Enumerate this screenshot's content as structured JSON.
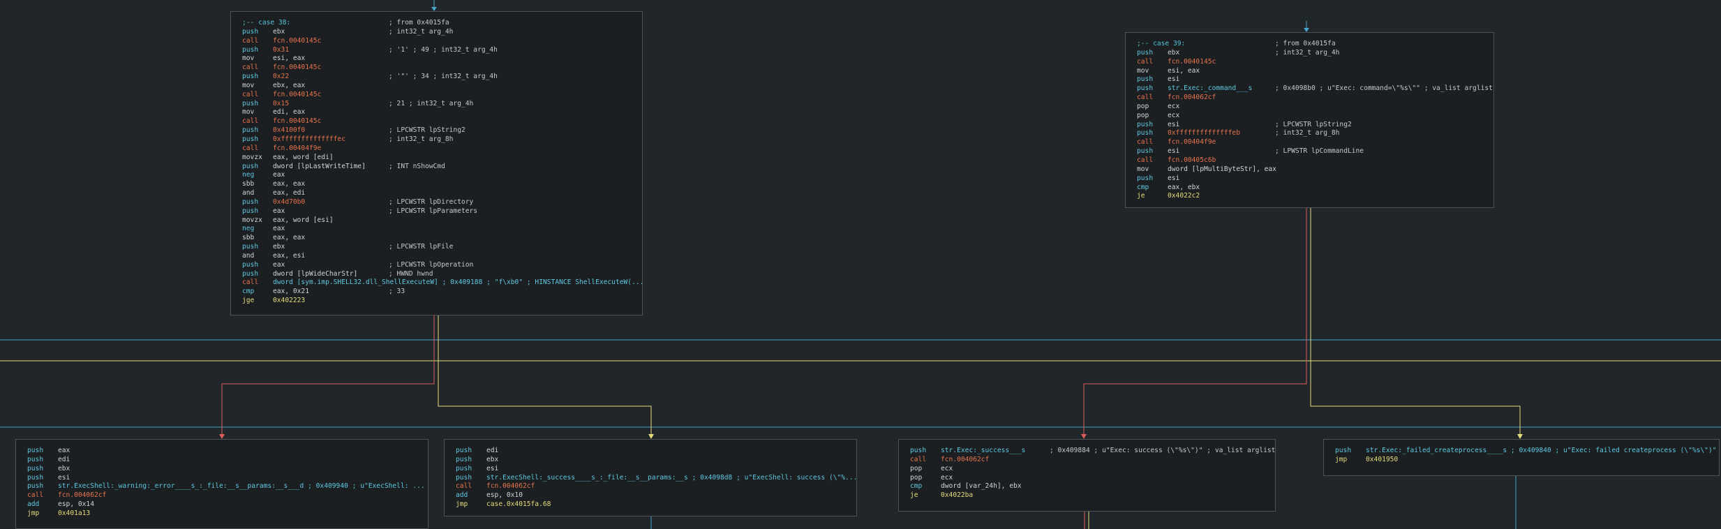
{
  "colors": {
    "background": "#21262a",
    "node_background": "#1b1f22",
    "node_border": "#4d5257",
    "edge_true": "#e6dc7a",
    "edge_false": "#e05c5c",
    "edge_unconditional": "#4aa3c8"
  },
  "nodes": {
    "case38": {
      "lines": [
        {
          "label": ";-- case 38:",
          "comment": "; from 0x4015fa"
        },
        {
          "m": "push",
          "o": "ebx",
          "ot": "reg",
          "c": "; int32_t arg_4h"
        },
        {
          "m": "call",
          "o": "fcn.0040145c",
          "ot": "fcn"
        },
        {
          "m": "push",
          "o": "0x31",
          "ot": "num-red",
          "c": "; '1' ; 49 ; int32_t arg_4h"
        },
        {
          "m": "mov",
          "o": "esi, eax",
          "ot": "reg"
        },
        {
          "m": "call",
          "o": "fcn.0040145c",
          "ot": "fcn"
        },
        {
          "m": "push",
          "o": "0x22",
          "ot": "num-red",
          "c": "; '\"' ; 34 ; int32_t arg_4h"
        },
        {
          "m": "mov",
          "o": "ebx, eax",
          "ot": "reg"
        },
        {
          "m": "call",
          "o": "fcn.0040145c",
          "ot": "fcn"
        },
        {
          "m": "push",
          "o": "0x15",
          "ot": "num-red",
          "c": "; 21 ; int32_t arg_4h"
        },
        {
          "m": "mov",
          "o": "edi, eax",
          "ot": "reg"
        },
        {
          "m": "call",
          "o": "fcn.0040145c",
          "ot": "fcn"
        },
        {
          "m": "push",
          "o": "0x4100f0",
          "ot": "num-red",
          "c": "; LPCWSTR lpString2"
        },
        {
          "m": "push",
          "o": "0xffffffffffffffec",
          "ot": "num-red",
          "c": "; int32_t arg_8h"
        },
        {
          "m": "call",
          "o": "fcn.00404f9e",
          "ot": "fcn"
        },
        {
          "m": "movzx",
          "o": "eax, word [edi]",
          "ot": "reg"
        },
        {
          "m": "push",
          "o": "dword [lpLastWriteTime]",
          "ot": "reg",
          "c": "; INT nShowCmd"
        },
        {
          "m": "neg",
          "o": "eax",
          "ot": "reg"
        },
        {
          "m": "sbb",
          "o": "eax, eax",
          "ot": "reg"
        },
        {
          "m": "and",
          "o": "eax, edi",
          "ot": "reg"
        },
        {
          "m": "push",
          "o": "0x4d70b0",
          "ot": "num-red",
          "c": "; LPCWSTR lpDirectory"
        },
        {
          "m": "push",
          "o": "eax",
          "ot": "reg",
          "c": "; LPCWSTR lpParameters"
        },
        {
          "m": "movzx",
          "o": "eax, word [esi]",
          "ot": "reg"
        },
        {
          "m": "neg",
          "o": "eax",
          "ot": "reg"
        },
        {
          "m": "sbb",
          "o": "eax, eax",
          "ot": "reg"
        },
        {
          "m": "push",
          "o": "ebx",
          "ot": "reg",
          "c": "; LPCWSTR lpFile"
        },
        {
          "m": "and",
          "o": "eax, esi",
          "ot": "reg"
        },
        {
          "m": "push",
          "o": "eax",
          "ot": "reg",
          "c": "; LPCWSTR lpOperation"
        },
        {
          "m": "push",
          "o": "dword [lpWideCharStr]",
          "ot": "reg",
          "c": "; HWND hwnd"
        },
        {
          "m": "call",
          "o": "dword [sym.imp.SHELL32.dll_ShellExecuteW] ; 0x409188 ; \"f\\xb0\" ; HINSTANCE ShellExecuteW(...",
          "ot": "str"
        },
        {
          "m": "cmp",
          "o": "eax, 0x21",
          "ot": "mix",
          "c": "; 33"
        },
        {
          "m": "jge",
          "o": "0x402223",
          "ot": "jmp"
        }
      ]
    },
    "case39": {
      "lines": [
        {
          "label": ";-- case 39:",
          "comment": "; from 0x4015fa"
        },
        {
          "m": "push",
          "o": "ebx",
          "ot": "reg",
          "c": "; int32_t arg_4h"
        },
        {
          "m": "call",
          "o": "fcn.0040145c",
          "ot": "fcn"
        },
        {
          "m": "mov",
          "o": "esi, eax",
          "ot": "reg"
        },
        {
          "m": "push",
          "o": "esi",
          "ot": "reg"
        },
        {
          "m": "push",
          "o": "str.Exec:_command___s",
          "ot": "str",
          "c": "; 0x4098b0 ; u\"Exec: command=\\\"%s\\\"\" ; va_list arglist"
        },
        {
          "m": "call",
          "o": "fcn.004062cf",
          "ot": "fcn"
        },
        {
          "m": "pop",
          "o": "ecx",
          "ot": "reg"
        },
        {
          "m": "pop",
          "o": "ecx",
          "ot": "reg"
        },
        {
          "m": "push",
          "o": "esi",
          "ot": "reg",
          "c": "; LPCWSTR lpString2"
        },
        {
          "m": "push",
          "o": "0xffffffffffffffeb",
          "ot": "num-red",
          "c": "; int32_t arg_8h"
        },
        {
          "m": "call",
          "o": "fcn.00404f9e",
          "ot": "fcn"
        },
        {
          "m": "push",
          "o": "esi",
          "ot": "reg",
          "c": "; LPWSTR lpCommandLine"
        },
        {
          "m": "call",
          "o": "fcn.00405c6b",
          "ot": "fcn"
        },
        {
          "m": "mov",
          "o": "dword [lpMultiByteStr], eax",
          "ot": "reg"
        },
        {
          "m": "push",
          "o": "esi",
          "ot": "reg"
        },
        {
          "m": "cmp",
          "o": "eax, ebx",
          "ot": "reg"
        },
        {
          "m": "je",
          "o": "0x4022c2",
          "ot": "jmp"
        }
      ]
    },
    "warning": {
      "lines": [
        {
          "m": "push",
          "o": "eax",
          "ot": "reg"
        },
        {
          "m": "push",
          "o": "edi",
          "ot": "reg"
        },
        {
          "m": "push",
          "o": "ebx",
          "ot": "reg"
        },
        {
          "m": "push",
          "o": "esi",
          "ot": "reg"
        },
        {
          "m": "push",
          "o": "str.ExecShell:_warning:_error____s_:_file:__s__params:__s___d ; 0x409940 ; u\"ExecShell: ...",
          "ot": "str"
        },
        {
          "m": "call",
          "o": "fcn.004062cf",
          "ot": "fcn"
        },
        {
          "m": "add",
          "o": "esp, 0x14",
          "ot": "mix"
        },
        {
          "m": "jmp",
          "o": "0x401a13",
          "ot": "jmp"
        }
      ]
    },
    "shellsuccess": {
      "lines": [
        {
          "m": "push",
          "o": "edi",
          "ot": "reg"
        },
        {
          "m": "push",
          "o": "ebx",
          "ot": "reg"
        },
        {
          "m": "push",
          "o": "esi",
          "ot": "reg"
        },
        {
          "m": "push",
          "o": "str.ExecShell:_success____s_:_file:__s__params:__s ; 0x4098d8 ; u\"ExecShell: success (\\\"%...",
          "ot": "str"
        },
        {
          "m": "call",
          "o": "fcn.004062cf",
          "ot": "fcn"
        },
        {
          "m": "add",
          "o": "esp, 0x10",
          "ot": "mix"
        },
        {
          "m": "jmp",
          "o": "case.0x4015fa.68",
          "ot": "jmp"
        }
      ]
    },
    "success": {
      "lines": [
        {
          "m": "push",
          "o": "str.Exec:_success___s",
          "ot": "str",
          "c": "; 0x409884 ; u\"Exec: success (\\\"%s\\\")\" ; va_list arglist"
        },
        {
          "m": "call",
          "o": "fcn.004062cf",
          "ot": "fcn"
        },
        {
          "m": "pop",
          "o": "ecx",
          "ot": "reg"
        },
        {
          "m": "pop",
          "o": "ecx",
          "ot": "reg"
        },
        {
          "m": "cmp",
          "o": "dword [var_24h], ebx",
          "ot": "reg"
        },
        {
          "m": "je",
          "o": "0x4022ba",
          "ot": "jmp"
        }
      ]
    },
    "failed": {
      "lines": [
        {
          "m": "push",
          "o": "str.Exec:_failed_createprocess____s ; 0x409840 ; u\"Exec: failed createprocess (\\\"%s\\\")\"",
          "ot": "str"
        },
        {
          "m": "jmp",
          "o": "0x401950",
          "ot": "jmp"
        }
      ]
    }
  }
}
